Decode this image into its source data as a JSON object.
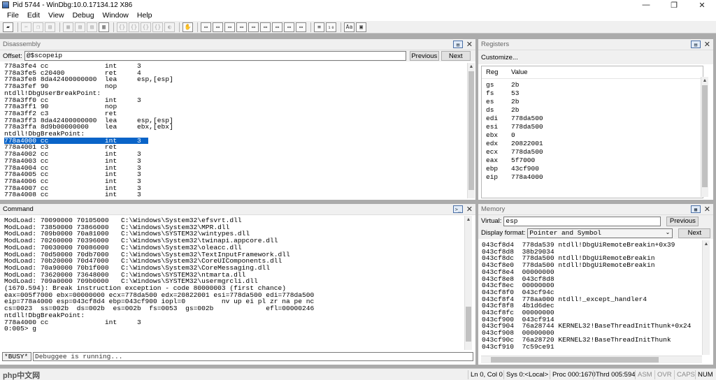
{
  "window": {
    "title": "Pid 5744 - WinDbg:10.0.17134.12 X86",
    "controls": {
      "minimize": "—",
      "maximize": "❐",
      "close": "✕"
    }
  },
  "menu": [
    "File",
    "Edit",
    "View",
    "Debug",
    "Window",
    "Help"
  ],
  "disassembly": {
    "title": "Disassembly",
    "offset_label": "Offset:",
    "offset_value": "@$scopeip",
    "previous_label": "Previous",
    "next_label": "Next",
    "lines": [
      {
        "text": "778a3fe4 cc              int     3",
        "highlight": false
      },
      {
        "text": "778a3fe5 c20400          ret     4",
        "highlight": false
      },
      {
        "text": "778a3fe8 8da42400000000  lea     esp,[esp]",
        "highlight": false
      },
      {
        "text": "778a3fef 90              nop",
        "highlight": false
      },
      {
        "text": "ntdll!DbgUserBreakPoint:",
        "highlight": false
      },
      {
        "text": "778a3ff0 cc              int     3",
        "highlight": false
      },
      {
        "text": "778a3ff1 90              nop",
        "highlight": false
      },
      {
        "text": "778a3ff2 c3              ret",
        "highlight": false
      },
      {
        "text": "778a3ff3 8da42400000000  lea     esp,[esp]",
        "highlight": false
      },
      {
        "text": "778a3ffa 8d9b00000000    lea     ebx,[ebx]",
        "highlight": false
      },
      {
        "text": "ntdll!DbgBreakPoint:",
        "highlight": false
      },
      {
        "text": "778a4000 cc              int     3",
        "highlight": true
      },
      {
        "text": "778a4001 c3              ret",
        "highlight": false
      },
      {
        "text": "778a4002 cc              int     3",
        "highlight": false
      },
      {
        "text": "778a4003 cc              int     3",
        "highlight": false
      },
      {
        "text": "778a4004 cc              int     3",
        "highlight": false
      },
      {
        "text": "778a4005 cc              int     3",
        "highlight": false
      },
      {
        "text": "778a4006 cc              int     3",
        "highlight": false
      },
      {
        "text": "778a4007 cc              int     3",
        "highlight": false
      },
      {
        "text": "778a4008 cc              int     3",
        "highlight": false
      }
    ]
  },
  "registers": {
    "title": "Registers",
    "customize_label": "Customize...",
    "col_reg": "Reg",
    "col_value": "Value",
    "rows": [
      {
        "reg": "gs",
        "value": "2b"
      },
      {
        "reg": "fs",
        "value": "53"
      },
      {
        "reg": "es",
        "value": "2b"
      },
      {
        "reg": "ds",
        "value": "2b"
      },
      {
        "reg": "edi",
        "value": "778da500"
      },
      {
        "reg": "esi",
        "value": "778da500"
      },
      {
        "reg": "ebx",
        "value": "0"
      },
      {
        "reg": "edx",
        "value": "20822001"
      },
      {
        "reg": "ecx",
        "value": "778da500"
      },
      {
        "reg": "eax",
        "value": "5f7000"
      },
      {
        "reg": "ebp",
        "value": "43cf900"
      },
      {
        "reg": "eip",
        "value": "778a4000"
      }
    ]
  },
  "command": {
    "title": "Command",
    "lines": [
      "ModLoad: 70090000 70105000   C:\\Windows\\System32\\efsvrt.dll",
      "ModLoad: 73850000 73866000   C:\\Windows\\System32\\MPR.dll",
      "ModLoad: 709b0000 70a81000   C:\\Windows\\SYSTEM32\\wintypes.dll",
      "ModLoad: 70260000 70396000   C:\\Windows\\System32\\twinapi.appcore.dll",
      "ModLoad: 70030000 70086000   C:\\Windows\\System32\\oleacc.dll",
      "ModLoad: 70d50000 70db7000   C:\\Windows\\System32\\TextInputFramework.dll",
      "ModLoad: 70b20000 70d47000   C:\\Windows\\System32\\CoreUIComponents.dll",
      "ModLoad: 70a90000 70b1f000   C:\\Windows\\System32\\CoreMessaging.dll",
      "ModLoad: 73620000 73648000   C:\\Windows\\SYSTEM32\\ntmarta.dll",
      "ModLoad: 709a0000 709b0000   C:\\Windows\\SYSTEM32\\usermgrcli.dll",
      "(1670.594): Break instruction exception - code 80000003 (first chance)",
      "eax=005f7000 ebx=00000000 ecx=778da500 edx=20822001 esi=778da500 edi=778da500",
      "eip=778a4000 esp=043cf8d4 ebp=043cf900 iopl=0         nv up ei pl zr na pe nc",
      "cs=0023  ss=002b  ds=002b  es=002b  fs=0053  gs=002b             efl=00000246",
      "ntdll!DbgBreakPoint:",
      "778a4000 cc              int     3",
      "0:005> g"
    ],
    "busy_label": "*BUSY*",
    "input_status": "Debuggee is running..."
  },
  "memory": {
    "title": "Memory",
    "virtual_label": "Virtual:",
    "virtual_value": "esp",
    "previous_label": "Previous",
    "display_format_label": "Display format:",
    "display_format_value": "Pointer and Symbol",
    "next_label": "Next",
    "lines": [
      "043cf8d4  778da539 ntdll!DbgUiRemoteBreakin+0x39",
      "043cf8d8  38b29034",
      "043cf8dc  778da500 ntdll!DbgUiRemoteBreakin",
      "043cf8e0  778da500 ntdll!DbgUiRemoteBreakin",
      "043cf8e4  00000000",
      "043cf8e8  043cf8d8",
      "043cf8ec  00000000",
      "043cf8f0  043cf94c",
      "043cf8f4  778aa000 ntdll!_except_handler4",
      "043cf8f8  4b1d6dec",
      "043cf8fc  00000000",
      "043cf900  043cf914",
      "043cf904  76a28744 KERNEL32!BaseThreadInitThunk+0x24",
      "043cf908  00000000",
      "043cf90c  76a28720 KERNEL32!BaseThreadInitThunk",
      "043cf910  7c59ce91"
    ]
  },
  "status": {
    "position": "Ln 0, Col 0",
    "sys": "Sys 0:<Local>",
    "proc": "Proc 000:1670",
    "thrd": "Thrd 005:594",
    "asm": "ASM",
    "ovr": "OVR",
    "caps": "CAPS",
    "num": "NUM"
  },
  "watermark_text": "php中文网"
}
